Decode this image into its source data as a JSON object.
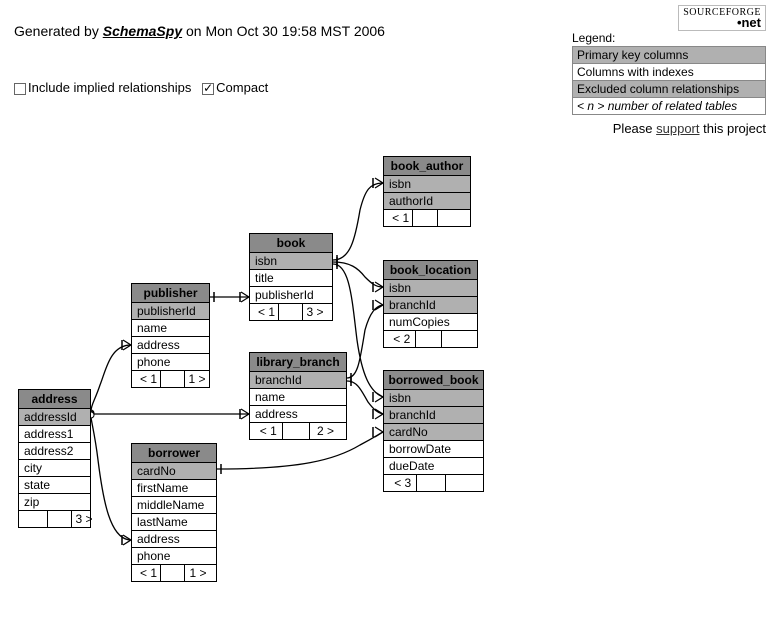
{
  "header": {
    "generated_prefix": "Generated by ",
    "tool_name": "SchemaSpy",
    "generated_suffix": " on Mon Oct 30 19:58 MST 2006"
  },
  "sourceforge": {
    "top": "SOURCEFORGE",
    "bottom": "•net"
  },
  "controls": {
    "implied_label": "Include implied relationships",
    "implied_checked": false,
    "compact_label": "Compact",
    "compact_checked": true
  },
  "legend": {
    "title": "Legend:",
    "rows": {
      "pk": "Primary key columns",
      "idx": "Columns with indexes",
      "ex": "Excluded column relationships",
      "rel_prefix": "< ",
      "rel_n": "n",
      "rel_suffix": " > number of related tables"
    },
    "support_prefix": "Please ",
    "support_link": "support",
    "support_suffix": " this project"
  },
  "chart_data": {
    "type": "diagram",
    "entities": [
      {
        "name": "address",
        "columns": [
          {
            "name": "addressId",
            "kind": "pk"
          },
          {
            "name": "address1",
            "kind": "idx"
          },
          {
            "name": "address2",
            "kind": "idx"
          },
          {
            "name": "city",
            "kind": "idx"
          },
          {
            "name": "state",
            "kind": "idx"
          },
          {
            "name": "zip",
            "kind": "idx"
          }
        ],
        "footer": [
          "",
          "",
          "3 >"
        ]
      },
      {
        "name": "publisher",
        "columns": [
          {
            "name": "publisherId",
            "kind": "pk"
          },
          {
            "name": "name",
            "kind": "idx"
          },
          {
            "name": "address",
            "kind": "idx"
          },
          {
            "name": "phone",
            "kind": "idx"
          }
        ],
        "footer": [
          "< 1",
          "",
          "1 >"
        ]
      },
      {
        "name": "borrower",
        "columns": [
          {
            "name": "cardNo",
            "kind": "pk"
          },
          {
            "name": "firstName",
            "kind": "idx"
          },
          {
            "name": "middleName",
            "kind": "idx"
          },
          {
            "name": "lastName",
            "kind": "idx"
          },
          {
            "name": "address",
            "kind": "idx"
          },
          {
            "name": "phone",
            "kind": "idx"
          }
        ],
        "footer": [
          "< 1",
          "",
          "1 >"
        ]
      },
      {
        "name": "book",
        "columns": [
          {
            "name": "isbn",
            "kind": "pk"
          },
          {
            "name": "title",
            "kind": "idx"
          },
          {
            "name": "publisherId",
            "kind": "idx"
          }
        ],
        "footer": [
          "< 1",
          "",
          "3 >"
        ]
      },
      {
        "name": "library_branch",
        "columns": [
          {
            "name": "branchId",
            "kind": "pk"
          },
          {
            "name": "name",
            "kind": "norm"
          },
          {
            "name": "address",
            "kind": "idx"
          }
        ],
        "footer": [
          "< 1",
          "",
          "2 >"
        ]
      },
      {
        "name": "book_author",
        "columns": [
          {
            "name": "isbn",
            "kind": "pk"
          },
          {
            "name": "authorId",
            "kind": "pk"
          }
        ],
        "footer": [
          "< 1",
          "",
          ""
        ]
      },
      {
        "name": "book_location",
        "columns": [
          {
            "name": "isbn",
            "kind": "pk"
          },
          {
            "name": "branchId",
            "kind": "pk"
          },
          {
            "name": "numCopies",
            "kind": "idx"
          }
        ],
        "footer": [
          "< 2",
          "",
          ""
        ]
      },
      {
        "name": "borrowed_book",
        "columns": [
          {
            "name": "isbn",
            "kind": "pk"
          },
          {
            "name": "branchId",
            "kind": "pk"
          },
          {
            "name": "cardNo",
            "kind": "pk"
          },
          {
            "name": "borrowDate",
            "kind": "idx"
          },
          {
            "name": "dueDate",
            "kind": "idx"
          }
        ],
        "footer": [
          "< 3",
          "",
          ""
        ]
      }
    ],
    "relationships": [
      {
        "from": "publisher.address",
        "to": "address.addressId"
      },
      {
        "from": "library_branch.address",
        "to": "address.addressId"
      },
      {
        "from": "borrower.address",
        "to": "address.addressId"
      },
      {
        "from": "book.publisherId",
        "to": "publisher.publisherId"
      },
      {
        "from": "book_author.isbn",
        "to": "book.isbn"
      },
      {
        "from": "book_location.isbn",
        "to": "book.isbn"
      },
      {
        "from": "borrowed_book.isbn",
        "to": "book.isbn"
      },
      {
        "from": "book_location.branchId",
        "to": "library_branch.branchId"
      },
      {
        "from": "borrowed_book.branchId",
        "to": "library_branch.branchId"
      },
      {
        "from": "borrowed_book.cardNo",
        "to": "borrower.cardNo"
      }
    ]
  }
}
